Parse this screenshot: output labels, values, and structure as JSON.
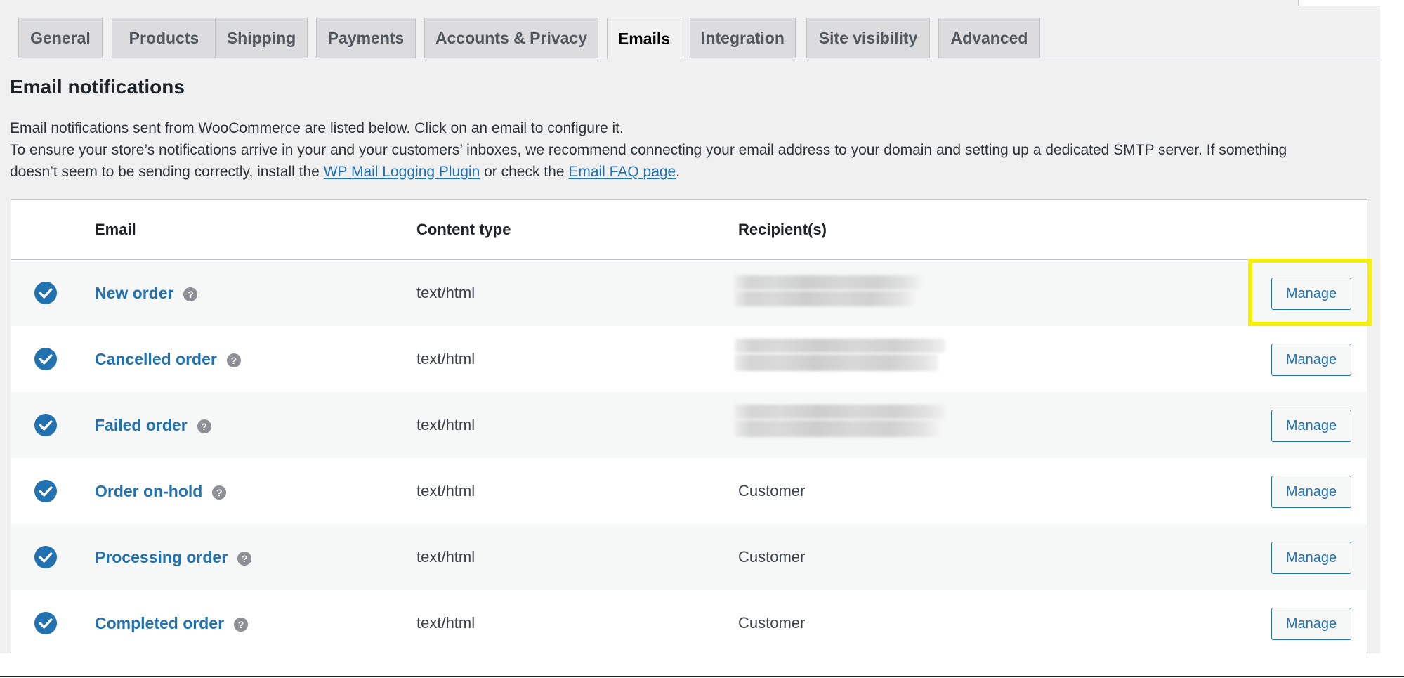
{
  "tabs": [
    {
      "label": "General"
    },
    {
      "label": "Products"
    },
    {
      "label": "Shipping"
    },
    {
      "label": "Payments"
    },
    {
      "label": "Accounts & Privacy"
    },
    {
      "label": "Emails",
      "active": true
    },
    {
      "label": "Integration"
    },
    {
      "label": "Site visibility"
    },
    {
      "label": "Advanced"
    }
  ],
  "section": {
    "title": "Email notifications",
    "line1": "Email notifications sent from WooCommerce are listed below. Click on an email to configure it.",
    "line2": "To ensure your store’s notifications arrive in your and your customers’ inboxes, we recommend connecting your email address to your domain and setting up a dedicated SMTP server. If something",
    "line3_prefix": "doesn’t seem to be sending correctly, install the ",
    "line3_link1": "WP Mail Logging Plugin",
    "line3_middle": " or check the ",
    "line3_link2": "Email FAQ page",
    "line3_suffix": "."
  },
  "table": {
    "headers": {
      "email": "Email",
      "content_type": "Content type",
      "recipients": "Recipient(s)"
    },
    "rows": [
      {
        "name": "New order",
        "type": "text/html",
        "recipient": "",
        "recipient_redacted": true,
        "action": "Manage"
      },
      {
        "name": "Cancelled order",
        "type": "text/html",
        "recipient": "",
        "recipient_redacted": true,
        "action": "Manage"
      },
      {
        "name": "Failed order",
        "type": "text/html",
        "recipient": "",
        "recipient_redacted": true,
        "action": "Manage"
      },
      {
        "name": "Order on-hold",
        "type": "text/html",
        "recipient": "Customer",
        "recipient_redacted": false,
        "action": "Manage"
      },
      {
        "name": "Processing order",
        "type": "text/html",
        "recipient": "Customer",
        "recipient_redacted": false,
        "action": "Manage"
      },
      {
        "name": "Completed order",
        "type": "text/html",
        "recipient": "Customer",
        "recipient_redacted": false,
        "action": "Manage"
      }
    ],
    "help_glyph": "?",
    "enabled_icon": "check-circle-icon"
  },
  "colors": {
    "accent": "#2271b1",
    "highlight": "#f5ef0a",
    "page_bg": "#f0f0f1"
  }
}
